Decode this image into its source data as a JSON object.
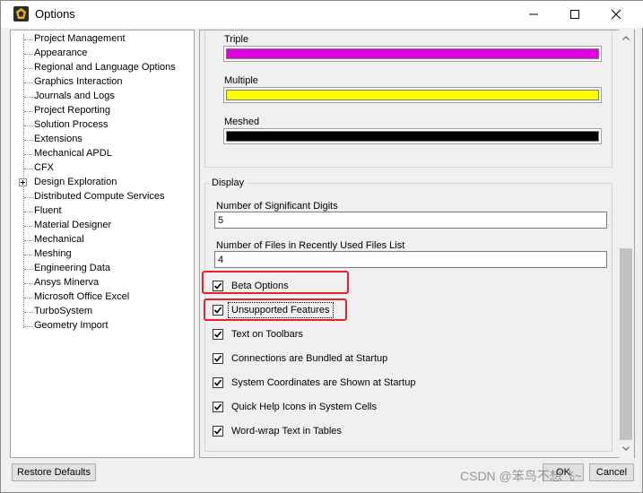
{
  "window": {
    "title": "Options"
  },
  "tree": {
    "items": [
      {
        "label": "Project Management"
      },
      {
        "label": "Appearance"
      },
      {
        "label": "Regional and Language Options"
      },
      {
        "label": "Graphics Interaction"
      },
      {
        "label": "Journals and Logs"
      },
      {
        "label": "Project Reporting"
      },
      {
        "label": "Solution Process"
      },
      {
        "label": "Extensions"
      },
      {
        "label": "Mechanical APDL"
      },
      {
        "label": "CFX"
      },
      {
        "label": "Design Exploration",
        "expandable": true
      },
      {
        "label": "Distributed Compute Services"
      },
      {
        "label": "Fluent"
      },
      {
        "label": "Material Designer"
      },
      {
        "label": "Mechanical"
      },
      {
        "label": "Meshing"
      },
      {
        "label": "Engineering Data"
      },
      {
        "label": "Ansys Minerva"
      },
      {
        "label": "Microsoft Office Excel"
      },
      {
        "label": "TurboSystem"
      },
      {
        "label": "Geometry Import"
      }
    ]
  },
  "colors": {
    "triple": {
      "label": "Triple",
      "value": "#e000e0"
    },
    "multiple": {
      "label": "Multiple",
      "value": "#ffff00"
    },
    "meshed": {
      "label": "Meshed",
      "value": "#000000"
    }
  },
  "display": {
    "section_label": "Display",
    "sig_digits": {
      "label": "Number of Significant Digits",
      "value": "5"
    },
    "recent_files": {
      "label": "Number of Files in Recently Used Files List",
      "value": "4"
    },
    "checks": [
      {
        "label": "Beta Options",
        "checked": true
      },
      {
        "label": "Unsupported Features",
        "checked": true
      },
      {
        "label": "Text on Toolbars",
        "checked": true
      },
      {
        "label": "Connections are Bundled at Startup",
        "checked": true
      },
      {
        "label": "System Coordinates are Shown at Startup",
        "checked": true
      },
      {
        "label": "Quick Help Icons in System Cells",
        "checked": true
      },
      {
        "label": "Word-wrap Text in Tables",
        "checked": true
      }
    ]
  },
  "buttons": {
    "restore_defaults": "Restore Defaults",
    "ok": "OK",
    "cancel": "Cancel"
  },
  "watermark": "CSDN @笨鸟不想飞~",
  "accent": {
    "highlight": "#e8212b"
  }
}
